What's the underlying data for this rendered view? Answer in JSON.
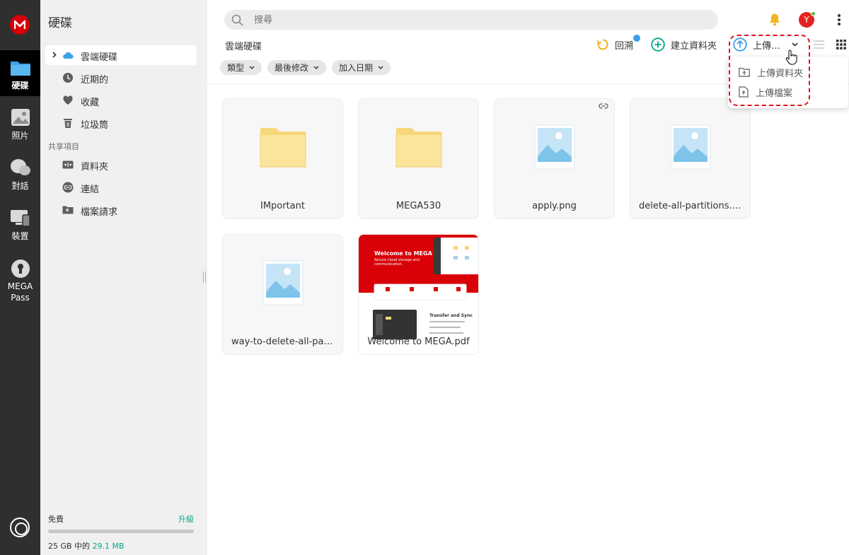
{
  "rail": {
    "items": [
      {
        "label": "硬碟"
      },
      {
        "label": "照片"
      },
      {
        "label": "對話"
      },
      {
        "label": "裝置"
      },
      {
        "label": "MEGA"
      },
      {
        "label": "Pass"
      }
    ]
  },
  "sidebar": {
    "title": "硬碟",
    "nav": [
      {
        "label": "雲端硬碟"
      },
      {
        "label": "近期的"
      },
      {
        "label": "收藏"
      },
      {
        "label": "垃圾筒"
      }
    ],
    "shared_label": "共享項目",
    "shared": [
      {
        "label": "資料夾"
      },
      {
        "label": "連結"
      },
      {
        "label": "檔案請求"
      }
    ],
    "storage": {
      "plan": "免費",
      "upgrade": "升級",
      "usage_prefix": "25 GB 中的",
      "used": "29.1 MB",
      "fraction": 0.0012
    }
  },
  "search": {
    "placeholder": "搜尋"
  },
  "avatar": {
    "initial": "Y"
  },
  "breadcrumb": "雲端硬碟",
  "toolbar": {
    "reload": "回溯",
    "new_folder": "建立資料夾",
    "upload": "上傳…"
  },
  "upload_menu": [
    {
      "label": "上傳資料夾"
    },
    {
      "label": "上傳檔案"
    }
  ],
  "filters": [
    {
      "label": "類型"
    },
    {
      "label": "最後修改"
    },
    {
      "label": "加入日期"
    }
  ],
  "files": [
    {
      "name": "IMportant",
      "kind": "folder"
    },
    {
      "name": "MEGA530",
      "kind": "folder"
    },
    {
      "name": "apply.png",
      "kind": "image",
      "linked": true
    },
    {
      "name": "delete-all-partitions.p...",
      "kind": "image"
    },
    {
      "name": "way-to-delete-all-par...",
      "kind": "image"
    },
    {
      "name": "Welcome to MEGA.pdf",
      "kind": "pdf"
    }
  ],
  "pdf_preview": {
    "heading": "Welcome to MEGA",
    "sub": "Secure cloud storage and communication.",
    "section": "Transfer and Sync"
  },
  "colors": {
    "brand": "#d90007",
    "accent": "#04a68a",
    "highlight": "#e4121f"
  }
}
